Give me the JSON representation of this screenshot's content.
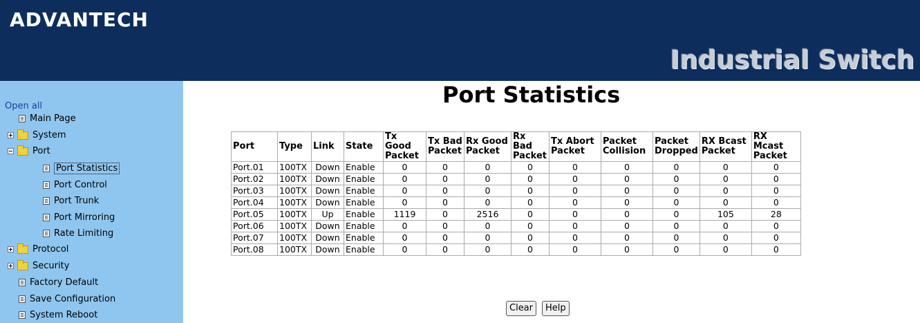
{
  "header": {
    "logo": "ADVANTECH",
    "title": "Industrial Switch"
  },
  "sidebar": {
    "open_all": "Open all",
    "items": [
      {
        "label": "Main Page"
      },
      {
        "label": "System"
      },
      {
        "label": "Port"
      },
      {
        "label": "Port Statistics"
      },
      {
        "label": "Port Control"
      },
      {
        "label": "Port Trunk"
      },
      {
        "label": "Port Mirroring"
      },
      {
        "label": "Rate Limiting"
      },
      {
        "label": "Protocol"
      },
      {
        "label": "Security"
      },
      {
        "label": "Factory Default"
      },
      {
        "label": "Save Configuration"
      },
      {
        "label": "System Reboot"
      }
    ]
  },
  "main": {
    "title": "Port Statistics",
    "columns": [
      "Port",
      "Type",
      "Link",
      "State",
      "Tx Good Packet",
      "Tx Bad Packet",
      "Rx Good Packet",
      "Rx Bad Packet",
      "Tx Abort Packet",
      "Packet Collision",
      "Packet Dropped",
      "RX Bcast Packet",
      "RX Mcast Packet"
    ],
    "rows": [
      [
        "Port.01",
        "100TX",
        "Down",
        "Enable",
        "0",
        "0",
        "0",
        "0",
        "0",
        "0",
        "0",
        "0",
        "0"
      ],
      [
        "Port.02",
        "100TX",
        "Down",
        "Enable",
        "0",
        "0",
        "0",
        "0",
        "0",
        "0",
        "0",
        "0",
        "0"
      ],
      [
        "Port.03",
        "100TX",
        "Down",
        "Enable",
        "0",
        "0",
        "0",
        "0",
        "0",
        "0",
        "0",
        "0",
        "0"
      ],
      [
        "Port.04",
        "100TX",
        "Down",
        "Enable",
        "0",
        "0",
        "0",
        "0",
        "0",
        "0",
        "0",
        "0",
        "0"
      ],
      [
        "Port.05",
        "100TX",
        "Up",
        "Enable",
        "1119",
        "0",
        "2516",
        "0",
        "0",
        "0",
        "0",
        "105",
        "28"
      ],
      [
        "Port.06",
        "100TX",
        "Down",
        "Enable",
        "0",
        "0",
        "0",
        "0",
        "0",
        "0",
        "0",
        "0",
        "0"
      ],
      [
        "Port.07",
        "100TX",
        "Down",
        "Enable",
        "0",
        "0",
        "0",
        "0",
        "0",
        "0",
        "0",
        "0",
        "0"
      ],
      [
        "Port.08",
        "100TX",
        "Down",
        "Enable",
        "0",
        "0",
        "0",
        "0",
        "0",
        "0",
        "0",
        "0",
        "0"
      ]
    ],
    "buttons": {
      "clear": "Clear",
      "help": "Help"
    }
  },
  "colors": {
    "header_bg": "#0d2e5c",
    "sidebar_bg": "#8fc6ef",
    "link": "#1a3fa0"
  }
}
